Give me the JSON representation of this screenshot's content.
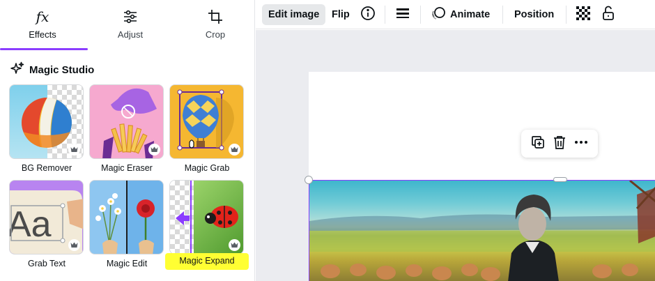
{
  "tabs": [
    {
      "label": "Effects",
      "icon": "fx-icon",
      "active": true
    },
    {
      "label": "Adjust",
      "icon": "sliders-icon",
      "active": false
    },
    {
      "label": "Crop",
      "icon": "crop-icon",
      "active": false
    }
  ],
  "section": {
    "title": "Magic Studio",
    "icon": "sparkle-icon"
  },
  "tools": [
    {
      "label": "BG Remover",
      "icon": "crown-icon"
    },
    {
      "label": "Magic Eraser",
      "icon": "crown-icon"
    },
    {
      "label": "Magic Grab",
      "icon": "crown-icon"
    },
    {
      "label": "Grab Text",
      "icon": "crown-icon"
    },
    {
      "label": "Magic Edit",
      "icon": "crown-icon"
    },
    {
      "label": "Magic Expand",
      "icon": "crown-icon",
      "highlighted": true
    }
  ],
  "toolbar": {
    "edit_image": "Edit image",
    "flip": "Flip",
    "animate": "Animate",
    "position": "Position"
  },
  "colors": {
    "accent": "#8b3dff",
    "highlight": "#ffff33",
    "canvas_bg": "#ebecf0"
  }
}
